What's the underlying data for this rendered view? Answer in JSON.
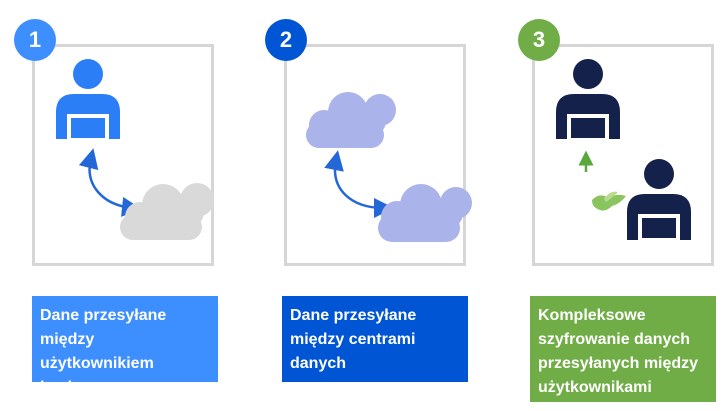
{
  "steps": [
    {
      "number": "1",
      "caption_lines": [
        "Dane przesyłane",
        "między użytkownikiem",
        "i usługą"
      ]
    },
    {
      "number": "2",
      "caption_lines": [
        "Dane przesyłane",
        "między centrami",
        "danych"
      ]
    },
    {
      "number": "3",
      "caption_lines": [
        "Kompleksowe",
        "szyfrowanie danych",
        "przesyłanych między",
        "użytkownikami"
      ]
    }
  ],
  "colors": {
    "step1": "#3d8eff",
    "step2": "#0055d4",
    "step3": "#70ad47",
    "user_blue": "#2b7ef5",
    "user_navy": "#14214a",
    "cloud_grey": "#d9d9d9",
    "cloud_lavender": "#aab3ea",
    "arrow_blue": "#2468d8",
    "arrow_green": "#5aa83c",
    "frame": "#d6d6d6"
  },
  "icons": [
    "user-laptop-icon",
    "cloud-icon",
    "bidirectional-arrow-icon",
    "up-arrow-icon",
    "bird-icon"
  ]
}
